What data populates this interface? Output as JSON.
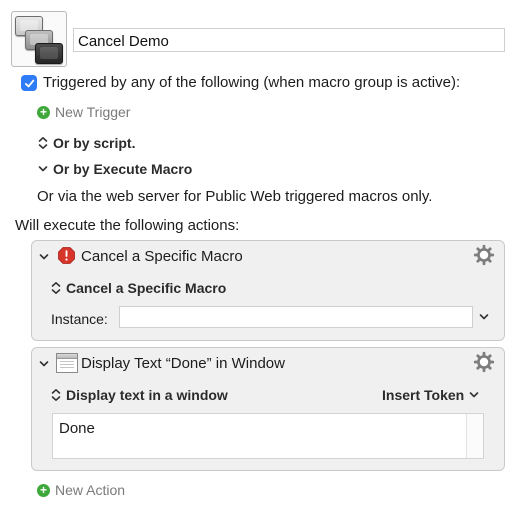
{
  "macro": {
    "name": "Cancel Demo",
    "icon": "keyboard-keys-icon"
  },
  "trigger": {
    "checked": true,
    "label": "Triggered by any of the following (when macro group is active):",
    "new_trigger_label": "New Trigger",
    "by_script_label": "Or by script.",
    "by_execute_label": "Or by Execute Macro",
    "web_server_text": "Or via the web server for Public Web triggered macros only."
  },
  "actions_header": "Will execute the following actions:",
  "actions": [
    {
      "title": "Cancel a Specific Macro",
      "icon": "stop-icon",
      "subheading": "Cancel a Specific Macro",
      "instance_label": "Instance:",
      "instance_value": ""
    },
    {
      "title": "Display Text “Done” in Window",
      "icon": "window-icon",
      "subheading": "Display text in a window",
      "insert_token_label": "Insert Token",
      "text_value": "Done"
    }
  ],
  "new_action_label": "New Action",
  "colors": {
    "accent": "#2f7cf6",
    "add_green": "#3ea83a",
    "stop_red": "#d8352a"
  }
}
